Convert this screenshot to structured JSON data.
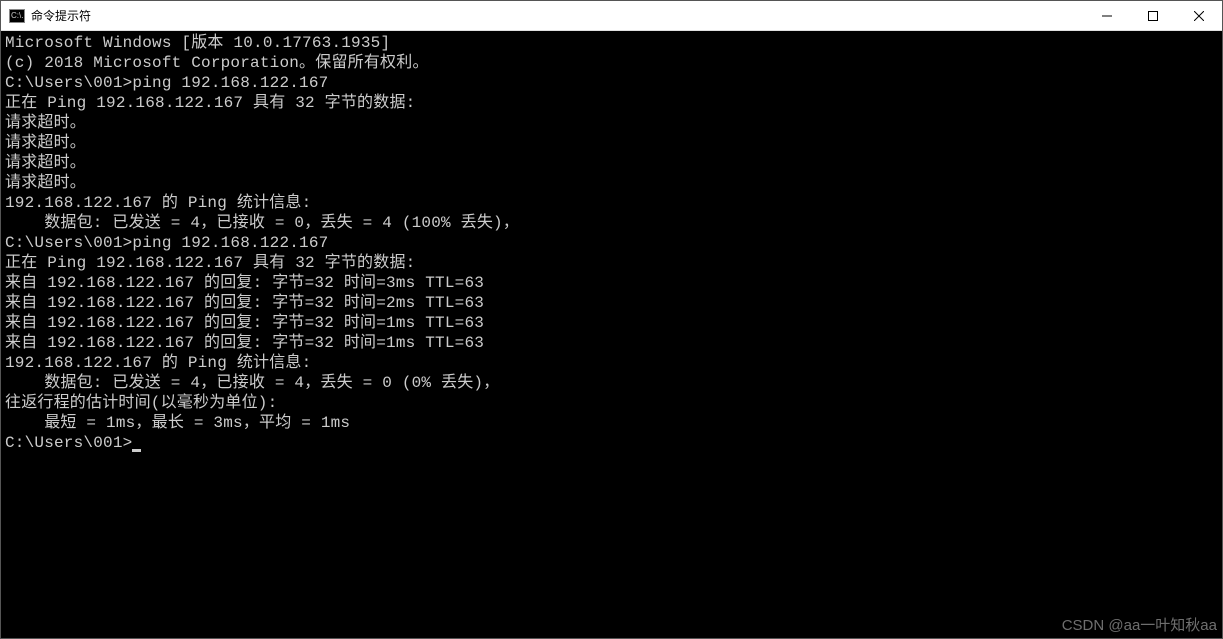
{
  "titlebar": {
    "icon_label": "C:\\.",
    "title": "命令提示符"
  },
  "terminal": {
    "lines": [
      "Microsoft Windows [版本 10.0.17763.1935]",
      "(c) 2018 Microsoft Corporation。保留所有权利。",
      "",
      "C:\\Users\\001>ping 192.168.122.167",
      "",
      "正在 Ping 192.168.122.167 具有 32 字节的数据:",
      "请求超时。",
      "请求超时。",
      "请求超时。",
      "请求超时。",
      "",
      "192.168.122.167 的 Ping 统计信息:",
      "    数据包: 已发送 = 4，已接收 = 0，丢失 = 4 (100% 丢失)，",
      "",
      "C:\\Users\\001>ping 192.168.122.167",
      "",
      "正在 Ping 192.168.122.167 具有 32 字节的数据:",
      "来自 192.168.122.167 的回复: 字节=32 时间=3ms TTL=63",
      "来自 192.168.122.167 的回复: 字节=32 时间=2ms TTL=63",
      "来自 192.168.122.167 的回复: 字节=32 时间=1ms TTL=63",
      "来自 192.168.122.167 的回复: 字节=32 时间=1ms TTL=63",
      "",
      "192.168.122.167 的 Ping 统计信息:",
      "    数据包: 已发送 = 4，已接收 = 4，丢失 = 0 (0% 丢失)，",
      "往返行程的估计时间(以毫秒为单位):",
      "    最短 = 1ms，最长 = 3ms，平均 = 1ms",
      "",
      "C:\\Users\\001>"
    ]
  },
  "watermark": "CSDN @aa一叶知秋aa"
}
